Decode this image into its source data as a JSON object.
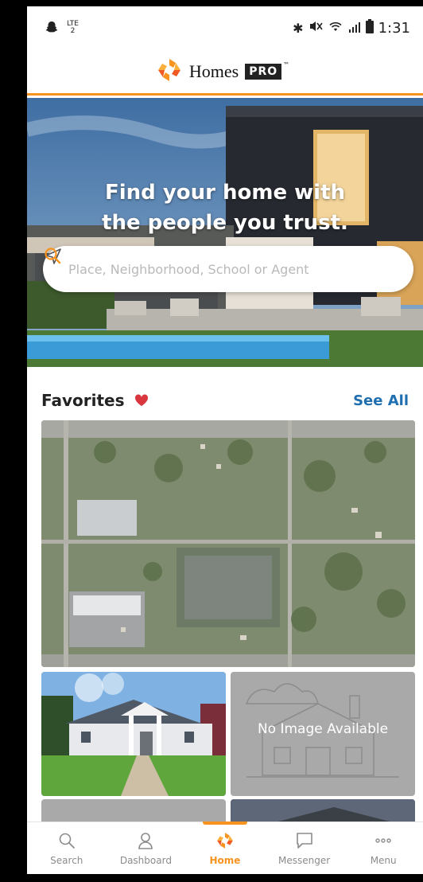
{
  "status_bar": {
    "network_type": "LTE",
    "network_sub": "2",
    "time": "1:31"
  },
  "brand": {
    "name": "Homes",
    "suffix": "PRO",
    "trademark": "™",
    "accent_color": "#f7931e"
  },
  "hero": {
    "title": "Find your home with the people you trust."
  },
  "search": {
    "placeholder": "Place, Neighborhood, School or Agent"
  },
  "favorites": {
    "title": "Favorites",
    "see_all": "See All",
    "no_image_text": "No Image Available"
  },
  "tabs": [
    {
      "label": "Search",
      "icon": "search-icon"
    },
    {
      "label": "Dashboard",
      "icon": "person-icon"
    },
    {
      "label": "Home",
      "icon": "homes-logo-icon",
      "active": true
    },
    {
      "label": "Messenger",
      "icon": "chat-icon"
    },
    {
      "label": "Menu",
      "icon": "dots-icon"
    }
  ]
}
